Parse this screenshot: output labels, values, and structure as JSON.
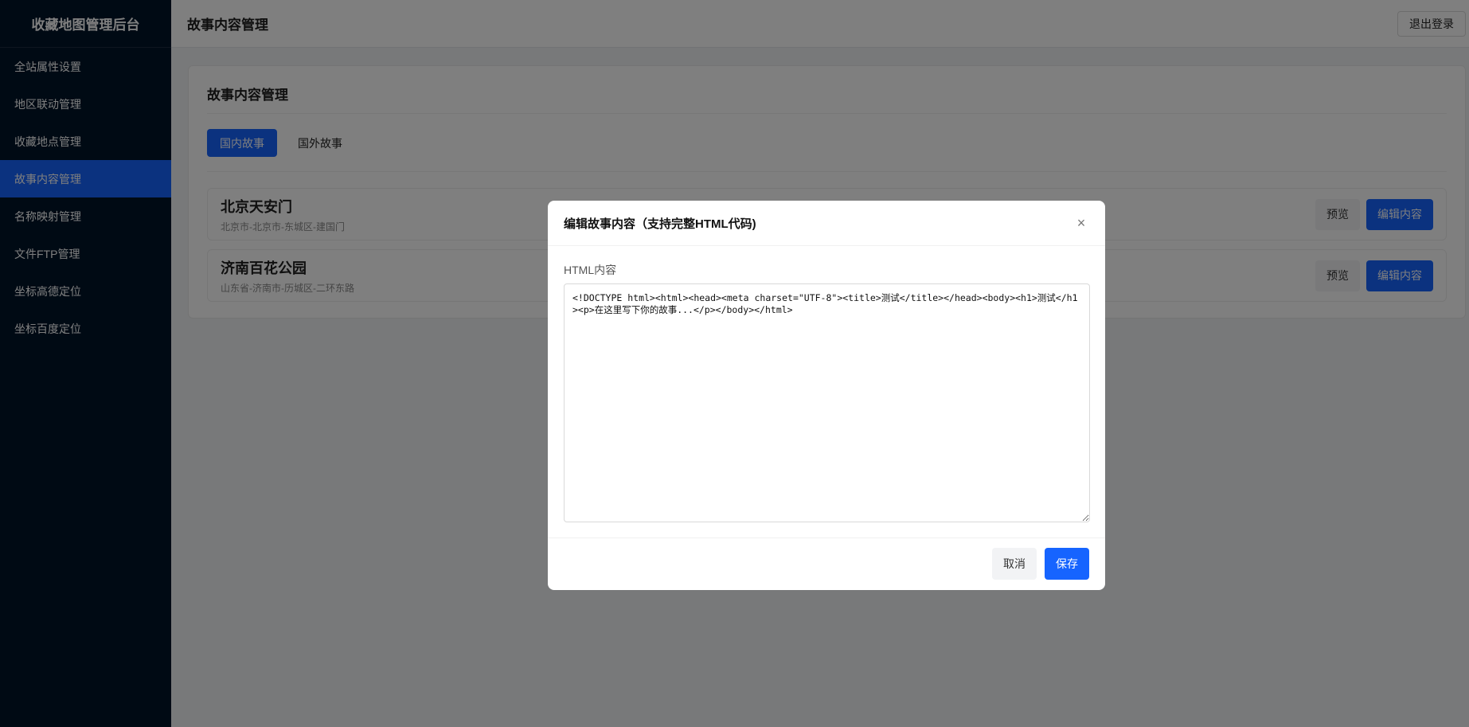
{
  "sidebar": {
    "brand": "收藏地图管理后台",
    "items": [
      {
        "label": "全站属性设置",
        "active": false
      },
      {
        "label": "地区联动管理",
        "active": false
      },
      {
        "label": "收藏地点管理",
        "active": false
      },
      {
        "label": "故事内容管理",
        "active": true
      },
      {
        "label": "名称映射管理",
        "active": false
      },
      {
        "label": "文件FTP管理",
        "active": false
      },
      {
        "label": "坐标高德定位",
        "active": false
      },
      {
        "label": "坐标百度定位",
        "active": false
      }
    ]
  },
  "header": {
    "title": "故事内容管理",
    "logout_label": "退出登录"
  },
  "main": {
    "title": "故事内容管理",
    "tabs": [
      {
        "label": "国内故事",
        "active": true
      },
      {
        "label": "国外故事",
        "active": false
      }
    ],
    "stories": [
      {
        "name": "北京天安门",
        "address": "北京市-北京市-东城区-建国门",
        "preview_label": "预览",
        "edit_label": "编辑内容"
      },
      {
        "name": "济南百花公园",
        "address": "山东省-济南市-历城区-二环东路",
        "preview_label": "预览",
        "edit_label": "编辑内容"
      }
    ]
  },
  "modal": {
    "title": "编辑故事内容（支持完整HTML代码)",
    "close_icon": "close-icon",
    "field_label": "HTML内容",
    "html_value": "<!DOCTYPE html><html><head><meta charset=\"UTF-8\"><title>测试</title></head><body><h1>测试</h1><p>在这里写下你的故事...</p></body></html>",
    "cancel_label": "取消",
    "save_label": "保存"
  },
  "colors": {
    "sidebar_bg": "#001529",
    "accent": "#1664ff",
    "overlay": "rgba(0,0,0,0.5)"
  }
}
